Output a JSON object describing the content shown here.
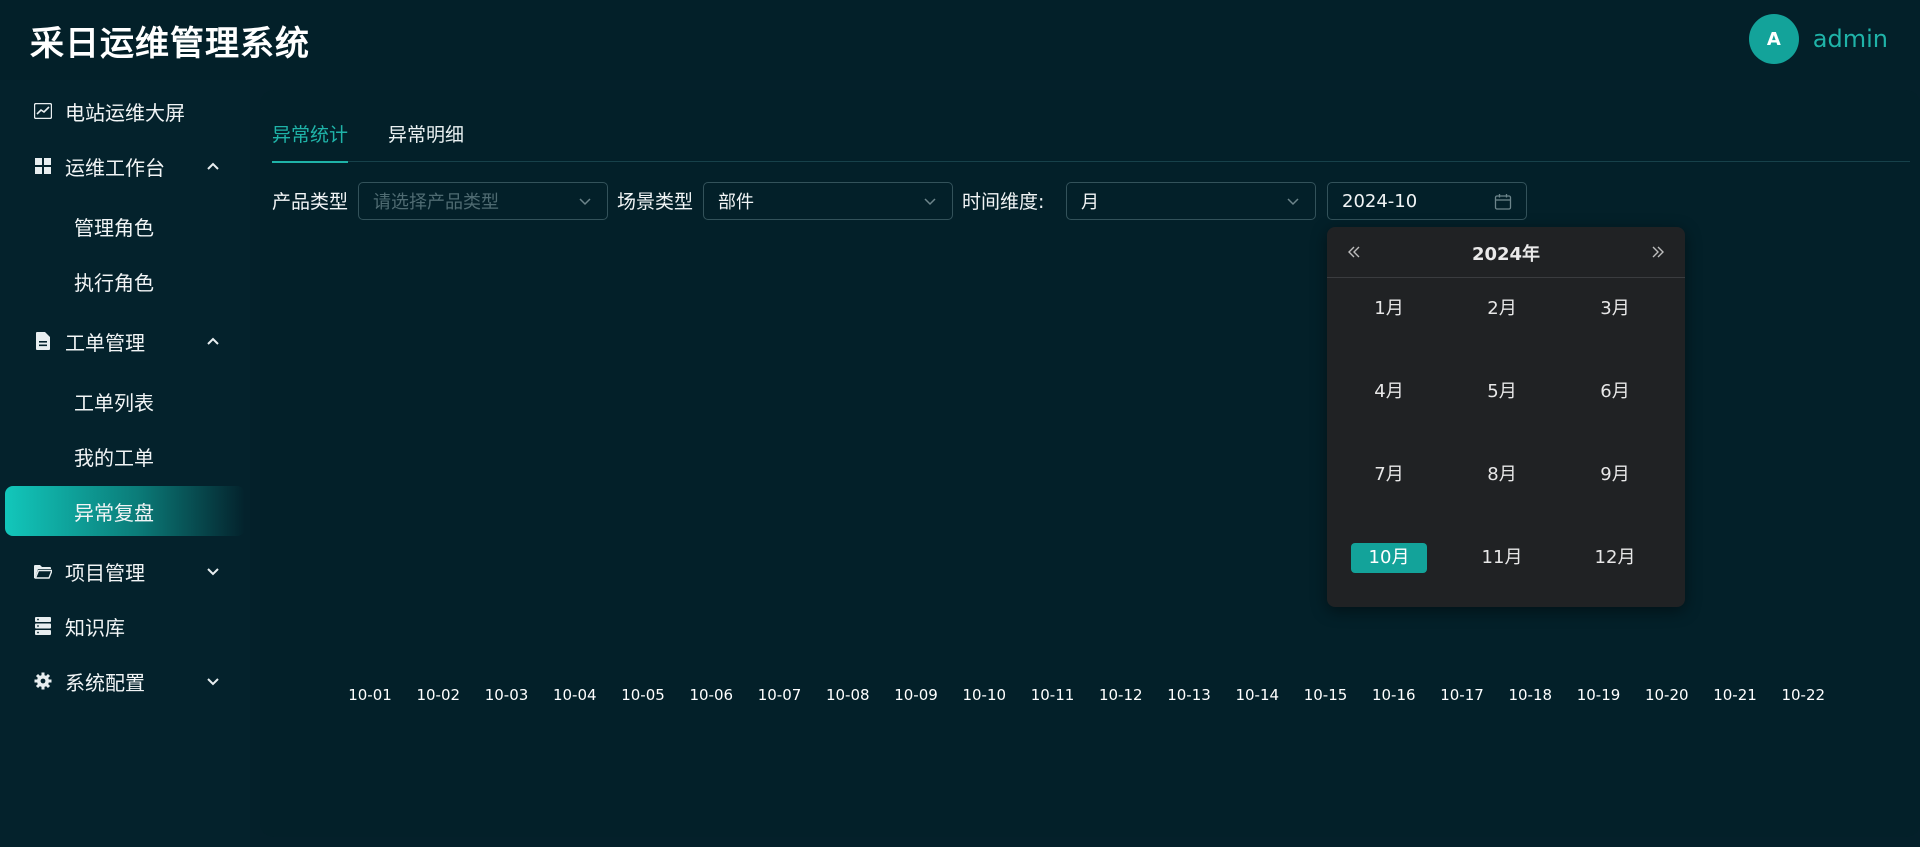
{
  "header": {
    "title": "采日运维管理系统",
    "user": {
      "avatar_letter": "A",
      "name": "admin"
    }
  },
  "sidebar": {
    "items": [
      {
        "label": "电站运维大屏",
        "icon": "chart-line-icon"
      },
      {
        "label": "运维工作台",
        "icon": "dashboard-grid-icon",
        "expanded": true,
        "children": [
          {
            "label": "管理角色"
          },
          {
            "label": "执行角色"
          }
        ]
      },
      {
        "label": "工单管理",
        "icon": "document-icon",
        "expanded": true,
        "children": [
          {
            "label": "工单列表"
          },
          {
            "label": "我的工单"
          },
          {
            "label": "异常复盘",
            "active": true
          }
        ]
      },
      {
        "label": "项目管理",
        "icon": "folder-icon",
        "expanded": false
      },
      {
        "label": "知识库",
        "icon": "database-icon"
      },
      {
        "label": "系统配置",
        "icon": "gear-icon",
        "expanded": false
      }
    ]
  },
  "tabs": [
    {
      "label": "异常统计",
      "active": true
    },
    {
      "label": "异常明细",
      "active": false
    }
  ],
  "filters": {
    "product_type": {
      "label": "产品类型",
      "value": "",
      "placeholder": "请选择产品类型"
    },
    "scene_type": {
      "label": "场景类型",
      "value": "部件"
    },
    "time_dimension": {
      "label": "时间维度:",
      "value": "月"
    },
    "date": {
      "value": "2024-10"
    }
  },
  "date_picker": {
    "year_label": "2024年",
    "months": [
      "1月",
      "2月",
      "3月",
      "4月",
      "5月",
      "6月",
      "7月",
      "8月",
      "9月",
      "10月",
      "11月",
      "12月"
    ],
    "selected": "10月"
  },
  "chart_data": {
    "type": "bar",
    "categories": [
      "10-01",
      "10-02",
      "10-03",
      "10-04",
      "10-05",
      "10-06",
      "10-07",
      "10-08",
      "10-09",
      "10-10",
      "10-11",
      "10-12",
      "10-13",
      "10-14",
      "10-15",
      "10-16",
      "10-17",
      "10-18",
      "10-19",
      "10-20",
      "10-21",
      "10-22"
    ],
    "values": [],
    "title": "",
    "xlabel": "",
    "ylabel": ""
  },
  "colors": {
    "accent": "#13a39a",
    "background": "#04202a",
    "panel": "#032029",
    "dropdown": "#202224"
  }
}
